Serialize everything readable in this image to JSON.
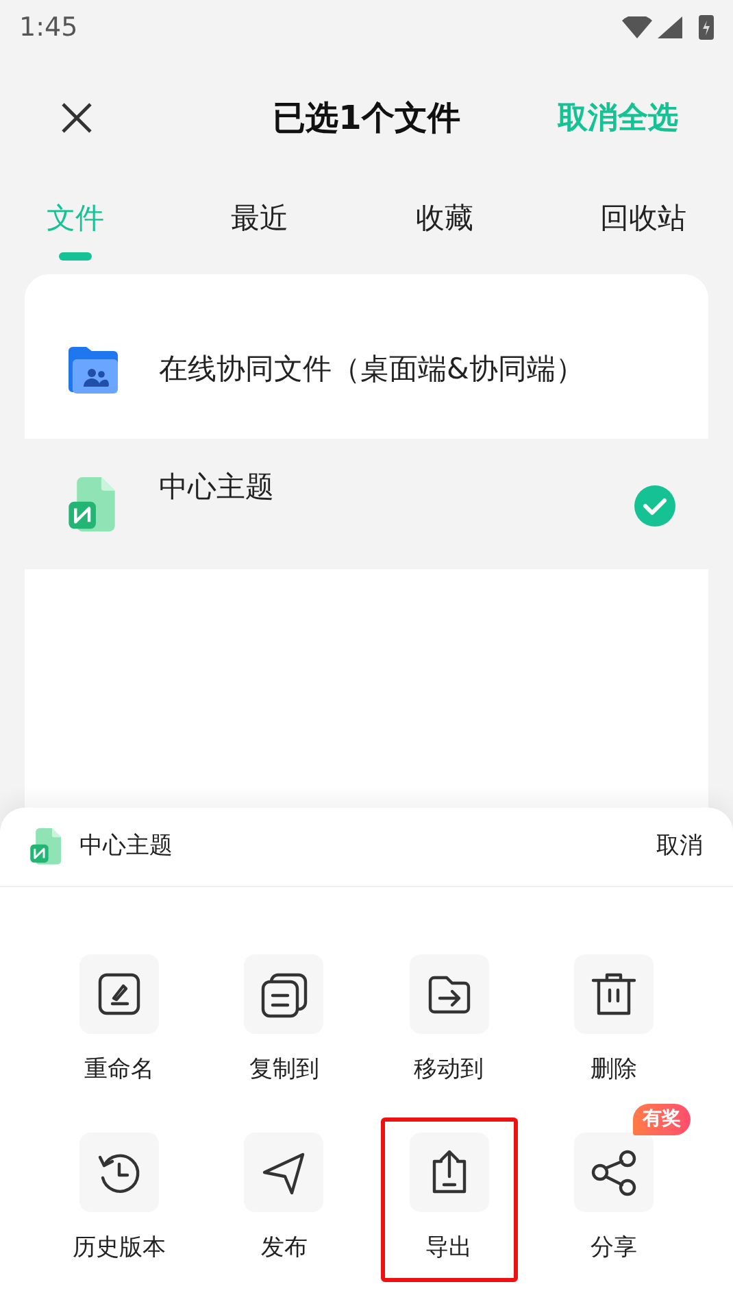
{
  "status_bar": {
    "time": "1:45"
  },
  "header": {
    "title": "已选1个文件",
    "action": "取消全选"
  },
  "tabs": [
    {
      "label": "文件",
      "selected": true
    },
    {
      "label": "最近",
      "selected": false
    },
    {
      "label": "收藏",
      "selected": false
    },
    {
      "label": "回收站",
      "selected": false
    }
  ],
  "files": [
    {
      "kind": "folder",
      "name": "在线协同文件（桌面端&协同端）",
      "selected": false
    },
    {
      "kind": "mindmap",
      "name": "中心主题",
      "selected": true
    }
  ],
  "sheet": {
    "file_name": "中心主题",
    "cancel": "取消",
    "actions": [
      {
        "kind": "rename",
        "label": "重命名",
        "highlighted": false
      },
      {
        "kind": "copy",
        "label": "复制到",
        "highlighted": false
      },
      {
        "kind": "move",
        "label": "移动到",
        "highlighted": false
      },
      {
        "kind": "delete",
        "label": "删除",
        "highlighted": false
      },
      {
        "kind": "history",
        "label": "历史版本",
        "highlighted": false
      },
      {
        "kind": "publish",
        "label": "发布",
        "highlighted": false
      },
      {
        "kind": "export",
        "label": "导出",
        "highlighted": true
      },
      {
        "kind": "share",
        "label": "分享",
        "highlighted": false,
        "badge": "有奖"
      }
    ]
  }
}
